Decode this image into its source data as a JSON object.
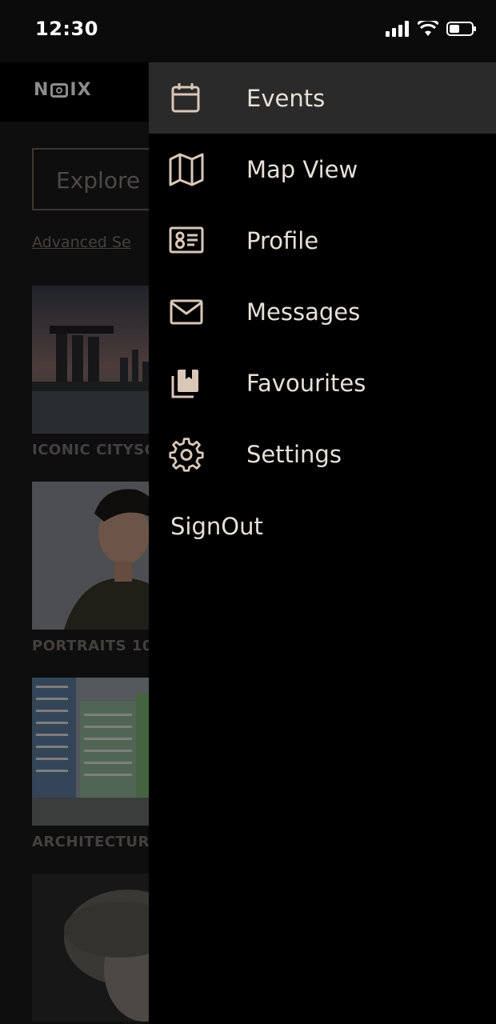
{
  "status": {
    "time": "12:30"
  },
  "header": {
    "logo_left": "N",
    "logo_right": "IX"
  },
  "main": {
    "search_label": "Explore",
    "advanced_search": "Advanced Se",
    "cards": [
      {
        "caption": "ICONIC CITYSC"
      },
      {
        "caption": "PORTRAITS 10"
      },
      {
        "caption": "ARCHITECTUR"
      },
      {
        "caption": ""
      }
    ]
  },
  "drawer": {
    "items": [
      {
        "label": "Events",
        "icon": "calendar-icon"
      },
      {
        "label": "Map View",
        "icon": "map-icon"
      },
      {
        "label": "Profile",
        "icon": "id-card-icon"
      },
      {
        "label": "Messages",
        "icon": "envelope-icon"
      },
      {
        "label": "Favourites",
        "icon": "bookmark-icon"
      },
      {
        "label": "Settings",
        "icon": "gear-icon"
      }
    ],
    "signout": "SignOut"
  },
  "colors": {
    "accent": "#d9c7b8",
    "active_bg": "#2a2a2b"
  }
}
